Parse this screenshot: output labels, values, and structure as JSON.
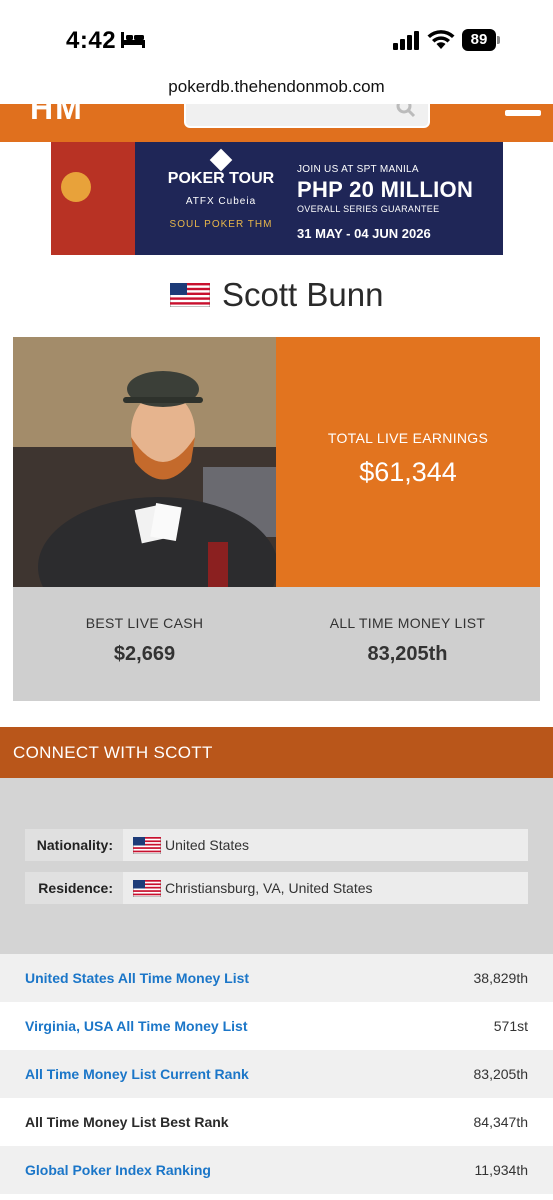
{
  "status_bar": {
    "time": "4:42",
    "battery": "89",
    "icons": [
      "bed-icon",
      "signal-icon",
      "wifi-icon",
      "battery-icon"
    ]
  },
  "browser": {
    "url": "pokerdb.thehendonmob.com"
  },
  "site_header": {
    "logo": "HM",
    "icons": [
      "search-icon",
      "menu-icon"
    ],
    "accent_color": "#e0701e"
  },
  "banner_ad": {
    "brand": "POKER TOUR",
    "partners": "ATFX   Cubeia",
    "partners2": "SOUL POKER   THM",
    "join_text": "JOIN US AT SPT MANILA",
    "prize": "PHP 20 MILLION",
    "guarantee": "OVERALL SERIES GUARANTEE",
    "dates": "31 MAY - 04 JUN 2026"
  },
  "player": {
    "name": "Scott Bunn",
    "flag": "us-flag-icon"
  },
  "stats": {
    "total_live_earnings_label": "TOTAL LIVE EARNINGS",
    "total_live_earnings": "$61,344",
    "best_live_cash_label": "BEST LIVE CASH",
    "best_live_cash": "$2,669",
    "all_time_money_list_label": "ALL TIME MONEY LIST",
    "all_time_money_list": "83,205th"
  },
  "connect": {
    "heading": "CONNECT WITH SCOTT"
  },
  "info": {
    "nationality_label": "Nationality:",
    "nationality": "United States",
    "residence_label": "Residence:",
    "residence": "Christiansburg, VA, United States"
  },
  "rankings": [
    {
      "label": "United States All Time Money List",
      "value": "38,829th",
      "link": true
    },
    {
      "label": "Virginia, USA All Time Money List",
      "value": "571st",
      "link": true
    },
    {
      "label": "All Time Money List Current Rank",
      "value": "83,205th",
      "link": true
    },
    {
      "label": "All Time Money List Best Rank",
      "value": "84,347th",
      "link": false
    },
    {
      "label": "Global Poker Index Ranking",
      "value": "11,934th",
      "link": true
    }
  ]
}
